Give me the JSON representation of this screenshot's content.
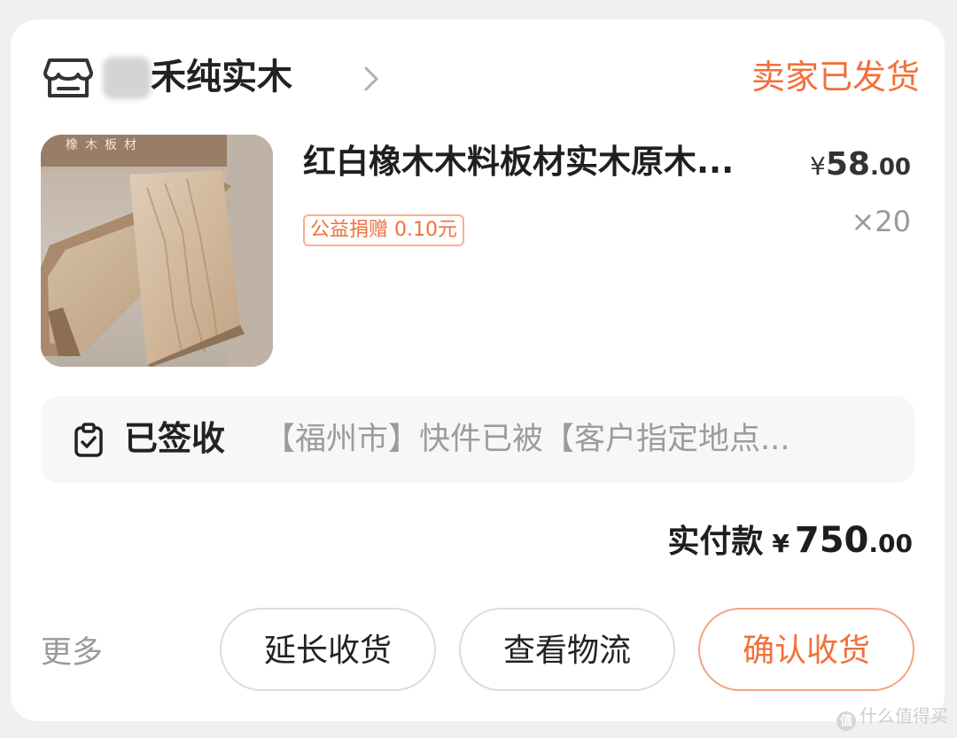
{
  "shop": {
    "name": "禾纯实木",
    "icon": "store-icon",
    "order_status": "卖家已发货"
  },
  "product": {
    "title": "红白橡木木料板材实木原木...",
    "thumb_text": "橡木板材",
    "price_symbol": "¥",
    "price_int": "58",
    "price_dec": ".00",
    "donation": "公益捐赠 0.10元",
    "quantity": "×20"
  },
  "logistics": {
    "icon": "clipboard-check-icon",
    "status": "已签收",
    "detail": "【福州市】快件已被【客户指定地点..."
  },
  "payment": {
    "label": "实付款",
    "symbol": "¥",
    "amount_int": "750",
    "amount_dec": ".00"
  },
  "actions": {
    "more": "更多",
    "extend_label": "延长收货",
    "track_label": "查看物流",
    "confirm_label": "确认收货"
  },
  "watermark": {
    "text": "什么值得买",
    "icon_text": "值"
  },
  "colors": {
    "accent": "#f2703a",
    "background": "#f0f0f2",
    "card": "#ffffff"
  }
}
